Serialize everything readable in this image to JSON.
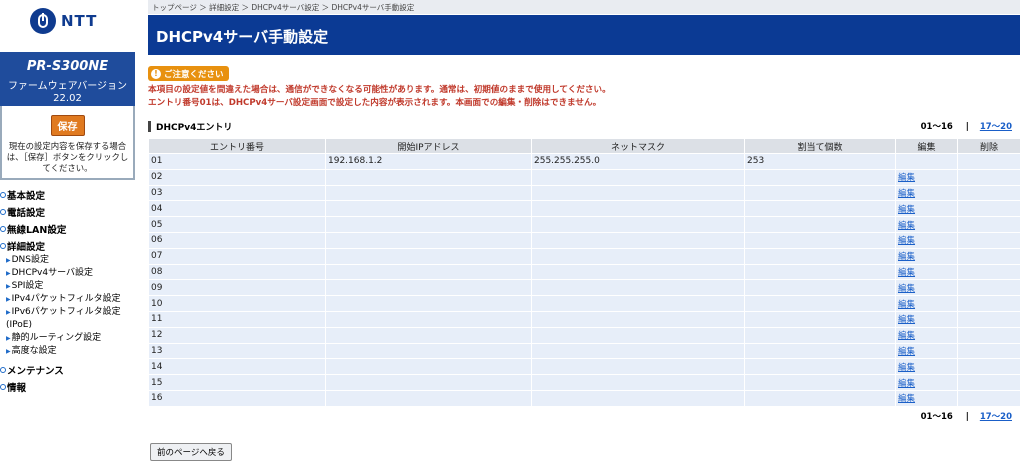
{
  "logo": {
    "text": "NTT"
  },
  "device": {
    "model": "PR-S300NE",
    "fw_label": "ファームウェアバージョン",
    "fw_version": "22.02"
  },
  "save": {
    "label": "保存",
    "note": "現在の設定内容を保存する場合は、［保存］ボタンをクリックしてください。"
  },
  "menu": {
    "basic": "基本設定",
    "phone": "電話設定",
    "wlan": "無線LAN設定",
    "advanced": "詳細設定",
    "advanced_items": [
      "DNS設定",
      "DHCPv4サーバ設定",
      "SPI設定",
      "IPv4パケットフィルタ設定",
      "IPv6パケットフィルタ設定",
      "(IPoE)",
      "静的ルーティング設定",
      "高度な設定"
    ],
    "maintenance": "メンテナンス",
    "info": "情報"
  },
  "breadcrumb": "トップページ ＞ 詳細設定 ＞ DHCPv4サーバ設定 ＞ DHCPv4サーバ手動設定",
  "page_title": "DHCPv4サーバ手動設定",
  "notice": {
    "badge": "ご注意ください",
    "line1": "本項目の設定値を間違えた場合は、通信ができなくなる可能性があります。通常は、初期値のままで使用してください。",
    "line2": "エントリ番号01は、DHCPv4サーバ設定画面で設定した内容が表示されます。本画面での編集・削除はできません。"
  },
  "section_title": "DHCPv4エントリ",
  "pager": {
    "current": "01～16",
    "sep": "|",
    "next": "17～20"
  },
  "table": {
    "headers": [
      "エントリ番号",
      "開始IPアドレス",
      "ネットマスク",
      "割当て個数",
      "編集",
      "削除"
    ],
    "edit_label": "編集",
    "rows": [
      {
        "no": "01",
        "ip": "192.168.1.2",
        "mask": "255.255.255.0",
        "count": "253",
        "edit": ""
      },
      {
        "no": "02",
        "ip": "",
        "mask": "",
        "count": "",
        "edit": "編集"
      },
      {
        "no": "03",
        "ip": "",
        "mask": "",
        "count": "",
        "edit": "編集"
      },
      {
        "no": "04",
        "ip": "",
        "mask": "",
        "count": "",
        "edit": "編集"
      },
      {
        "no": "05",
        "ip": "",
        "mask": "",
        "count": "",
        "edit": "編集"
      },
      {
        "no": "06",
        "ip": "",
        "mask": "",
        "count": "",
        "edit": "編集"
      },
      {
        "no": "07",
        "ip": "",
        "mask": "",
        "count": "",
        "edit": "編集"
      },
      {
        "no": "08",
        "ip": "",
        "mask": "",
        "count": "",
        "edit": "編集"
      },
      {
        "no": "09",
        "ip": "",
        "mask": "",
        "count": "",
        "edit": "編集"
      },
      {
        "no": "10",
        "ip": "",
        "mask": "",
        "count": "",
        "edit": "編集"
      },
      {
        "no": "11",
        "ip": "",
        "mask": "",
        "count": "",
        "edit": "編集"
      },
      {
        "no": "12",
        "ip": "",
        "mask": "",
        "count": "",
        "edit": "編集"
      },
      {
        "no": "13",
        "ip": "",
        "mask": "",
        "count": "",
        "edit": "編集"
      },
      {
        "no": "14",
        "ip": "",
        "mask": "",
        "count": "",
        "edit": "編集"
      },
      {
        "no": "15",
        "ip": "",
        "mask": "",
        "count": "",
        "edit": "編集"
      },
      {
        "no": "16",
        "ip": "",
        "mask": "",
        "count": "",
        "edit": "編集"
      }
    ]
  },
  "back_button": "前のページへ戻る",
  "colors": {
    "brand": "#0b3a94",
    "notice": "#c0392b",
    "badge": "#e8910f",
    "link": "#1a5fc8"
  }
}
